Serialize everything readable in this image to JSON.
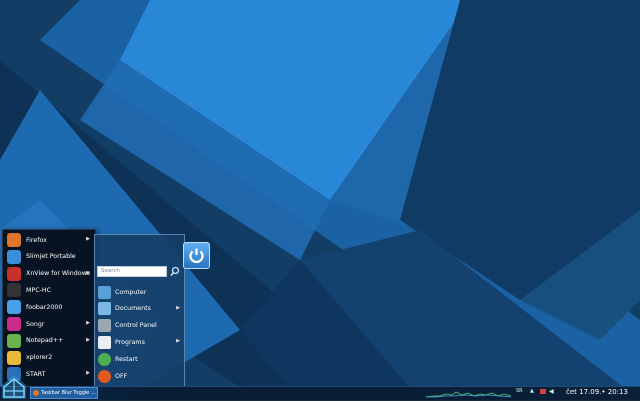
{
  "start_menu": {
    "programs": [
      {
        "label": "Firefox",
        "icon": "firefox-icon",
        "has_submenu": true,
        "color": "#e0762a"
      },
      {
        "label": "Slimjet Portable",
        "icon": "slimjet-icon",
        "has_submenu": false,
        "color": "#3a8fd8"
      },
      {
        "label": "XnView for Windows",
        "icon": "xnview-icon",
        "has_submenu": true,
        "color": "#c8302a"
      },
      {
        "label": "MPC-HC",
        "icon": "mpc-hc-icon",
        "has_submenu": false,
        "color": "#333333"
      },
      {
        "label": "foobar2000",
        "icon": "foobar2000-icon",
        "has_submenu": false,
        "color": "#4aa0e6"
      },
      {
        "label": "Songr",
        "icon": "songr-icon",
        "has_submenu": true,
        "color": "#cc2a8a"
      },
      {
        "label": "Notepad++",
        "icon": "notepad-plus-plus-icon",
        "has_submenu": true,
        "color": "#6ab04c"
      },
      {
        "label": "xplorer2",
        "icon": "xplorer2-icon",
        "has_submenu": false,
        "color": "#e8b838"
      },
      {
        "label": "START",
        "icon": "start-icon",
        "has_submenu": true,
        "color": "#2a6fb8"
      }
    ],
    "search": {
      "placeholder": "Search"
    },
    "system_items": [
      {
        "label": "Computer",
        "icon": "computer-icon",
        "has_submenu": false,
        "color": "#5aa0d8"
      },
      {
        "label": "Documents",
        "icon": "documents-icon",
        "has_submenu": true,
        "color": "#7ab8e8"
      },
      {
        "label": "Control Panel",
        "icon": "control-panel-icon",
        "has_submenu": false,
        "color": "#9aa6b0"
      },
      {
        "label": "Programs",
        "icon": "programs-icon",
        "has_submenu": true,
        "color": "#e8eef4"
      },
      {
        "label": "Restart",
        "icon": "restart-icon",
        "has_submenu": false,
        "color": "#4cb050"
      },
      {
        "label": "OFF",
        "icon": "power-off-icon",
        "has_submenu": false,
        "color": "#e05a20"
      }
    ]
  },
  "taskbar": {
    "item_label": "Taskbar Blur Toggle ...",
    "tray_language": "SR",
    "clock": "čet 17.09.• 20:13"
  },
  "colors": {
    "wallpaper_dark": "#0f3a62",
    "wallpaper_mid": "#1a5f9e",
    "wallpaper_light": "#2a86d8"
  }
}
